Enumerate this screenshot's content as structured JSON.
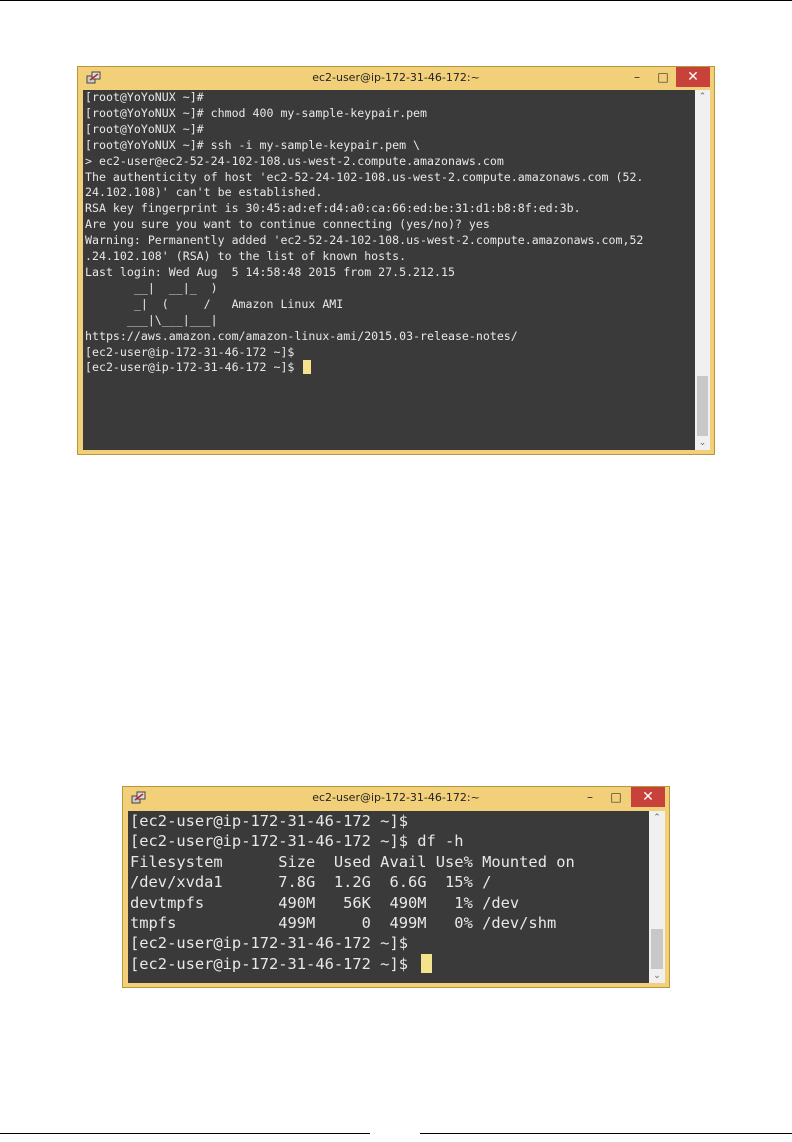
{
  "windows": [
    {
      "title": "ec2-user@ip-172-31-46-172:~",
      "controls": {
        "minimize": "–",
        "maximize": "□",
        "close": "✕"
      },
      "lines": [
        "[root@YoYoNUX ~]#",
        "[root@YoYoNUX ~]# chmod 400 my-sample-keypair.pem",
        "[root@YoYoNUX ~]#",
        "[root@YoYoNUX ~]# ssh -i my-sample-keypair.pem \\",
        "> ec2-user@ec2-52-24-102-108.us-west-2.compute.amazonaws.com",
        "The authenticity of host 'ec2-52-24-102-108.us-west-2.compute.amazonaws.com (52.",
        "24.102.108)' can't be established.",
        "RSA key fingerprint is 30:45:ad:ef:d4:a0:ca:66:ed:be:31:d1:b8:8f:ed:3b.",
        "Are you sure you want to continue connecting (yes/no)? yes",
        "Warning: Permanently added 'ec2-52-24-102-108.us-west-2.compute.amazonaws.com,52",
        ".24.102.108' (RSA) to the list of known hosts.",
        "Last login: Wed Aug  5 14:58:48 2015 from 27.5.212.15",
        "",
        "       __|  __|_  )",
        "       _|  (     /   Amazon Linux AMI",
        "      ___|\\___|___|",
        "",
        "https://aws.amazon.com/amazon-linux-ami/2015.03-release-notes/",
        "[ec2-user@ip-172-31-46-172 ~]$",
        "[ec2-user@ip-172-31-46-172 ~]$ "
      ],
      "scroll_position": 0.78
    },
    {
      "title": "ec2-user@ip-172-31-46-172:~",
      "controls": {
        "minimize": "–",
        "maximize": "□",
        "close": "✕"
      },
      "lines": [
        "[ec2-user@ip-172-31-46-172 ~]$",
        "[ec2-user@ip-172-31-46-172 ~]$ df -h",
        "Filesystem      Size  Used Avail Use% Mounted on",
        "/dev/xvda1      7.8G  1.2G  6.6G  15% /",
        "devtmpfs        490M   56K  490M   1% /dev",
        "tmpfs           499M     0  499M   0% /dev/shm",
        "[ec2-user@ip-172-31-46-172 ~]$",
        "[ec2-user@ip-172-31-46-172 ~]$ "
      ],
      "scroll_position": 0.72
    }
  ],
  "colors": {
    "terminal_bg": "#3a3a3a",
    "terminal_fg": "#e8e8e8",
    "cursor": "#f4e38c",
    "window_frame": "#f2d07a",
    "close_button": "#c7423a"
  },
  "icons": [
    "putty-icon",
    "minimize-icon",
    "maximize-icon",
    "close-icon",
    "scroll-up-icon",
    "scroll-down-icon"
  ]
}
